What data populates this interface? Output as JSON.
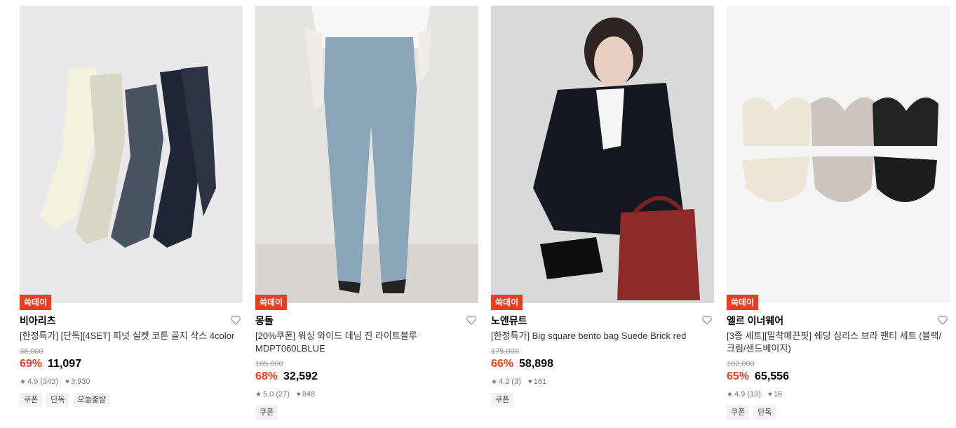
{
  "products": [
    {
      "badge": "쓱데이",
      "brand": "비아리츠",
      "title": "[한정특가] [단독][4SET] 피넛 실켓 코튼 골지 삭스 4color",
      "original_price": "36,000",
      "discount": "69%",
      "price": "11,097",
      "rating": "4.9 (343)",
      "likes": "3,930",
      "tags": [
        "쿠폰",
        "단독",
        "오늘출발"
      ]
    },
    {
      "badge": "쓱데이",
      "brand": "몽돌",
      "title": "[20%쿠폰] 워싱 와이드 데님 진 라이트블루 MDPT060LBLUE",
      "original_price": "105,000",
      "discount": "68%",
      "price": "32,592",
      "rating": "5.0 (27)",
      "likes": "848",
      "tags": [
        "쿠폰"
      ]
    },
    {
      "badge": "쓱데이",
      "brand": "노앤뮤트",
      "title": "[한정특가] Big square bento bag Suede Brick red",
      "original_price": "175,000",
      "discount": "66%",
      "price": "58,898",
      "rating": "4.3 (3)",
      "likes": "161",
      "tags": [
        "쿠폰"
      ]
    },
    {
      "badge": "쓱데이",
      "brand": "엘르 이너웨어",
      "title": "[3종 세트][밀착매끈핏] 쉐딩 심리스 브라 팬티 세트 (블랙/크림/샌드베이지)",
      "original_price": "102,000",
      "discount": "65%",
      "price": "65,556",
      "rating": "4.9 (10)",
      "likes": "16",
      "tags": [
        "쿠폰",
        "단독"
      ]
    }
  ],
  "icons": {
    "heart": "heart-outline-icon",
    "star": "star-icon",
    "like": "heart-filled-icon"
  },
  "colors": {
    "accent": "#f13b1d",
    "muted": "#9a9a9a"
  }
}
